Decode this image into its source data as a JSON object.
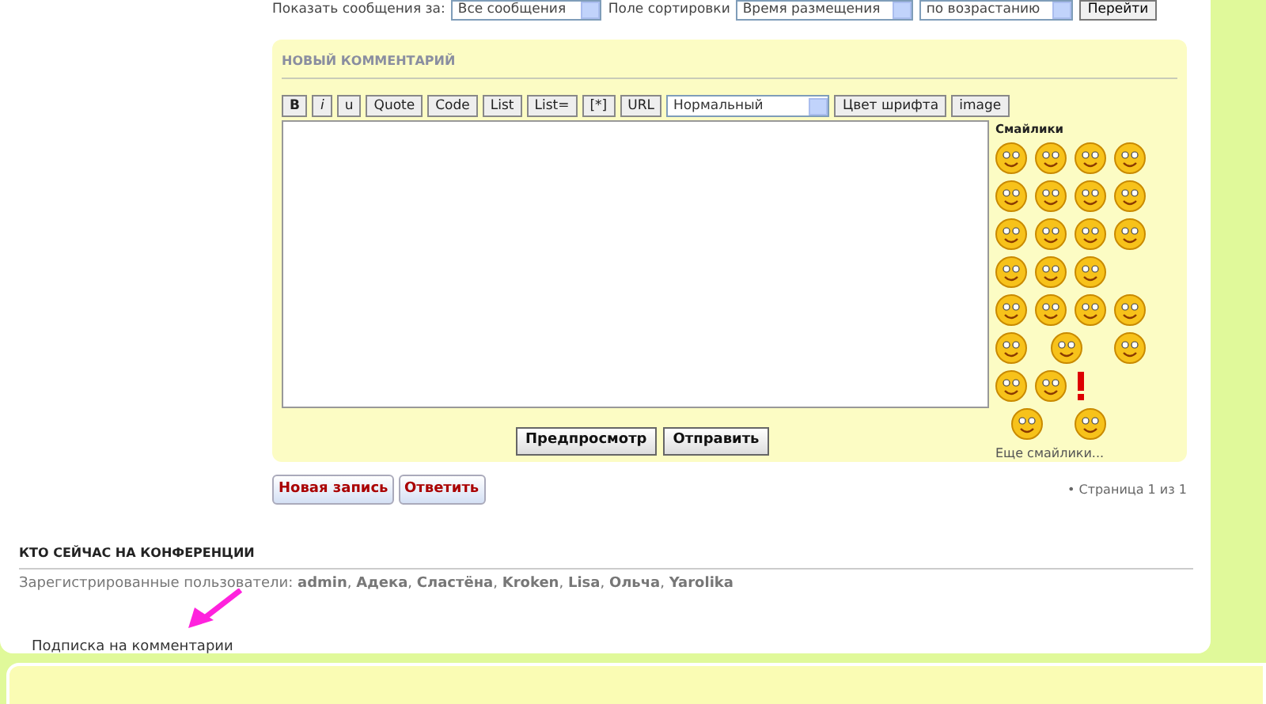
{
  "filter_bar": {
    "show_label": "Показать сообщения за:",
    "show_select": "Все сообщения",
    "sort_label": "Поле сортировки",
    "sort_select": "Время размещения",
    "order_select": "по возрастанию",
    "go_button": "Перейти"
  },
  "comment_form": {
    "title": "НОВЫЙ КОММЕНТАРИЙ",
    "toolbar": [
      {
        "kind": "button",
        "label": "B"
      },
      {
        "kind": "button",
        "label": "i"
      },
      {
        "kind": "button",
        "label": "u"
      },
      {
        "kind": "button",
        "label": "Quote"
      },
      {
        "kind": "button",
        "label": "Code"
      },
      {
        "kind": "button",
        "label": "List"
      },
      {
        "kind": "button",
        "label": "List="
      },
      {
        "kind": "button",
        "label": "[*]"
      },
      {
        "kind": "button",
        "label": "URL"
      },
      {
        "kind": "select",
        "label": "Нормальный"
      },
      {
        "kind": "button",
        "label": "Цвет шрифта"
      },
      {
        "kind": "button",
        "label": "image"
      }
    ],
    "smileys_title": "Смайлики",
    "more_smileys": "Еще смайлики...",
    "buttons": [
      "Предпросмотр",
      "Отправить"
    ]
  },
  "actions": [
    "Новая запись",
    "Ответить"
  ],
  "pagination": "• Страница 1 из 1",
  "online": {
    "title": "КТО СЕЙЧАС НА КОНФЕРЕНЦИИ",
    "users_line": "Зарегистрированные пользователи: **admin**, **Адека**, **Сластёна**, **Kroken**, **Lisa**, **Ольча**, **Yarolika**"
  },
  "subscribe": "Подписка на комментарии"
}
